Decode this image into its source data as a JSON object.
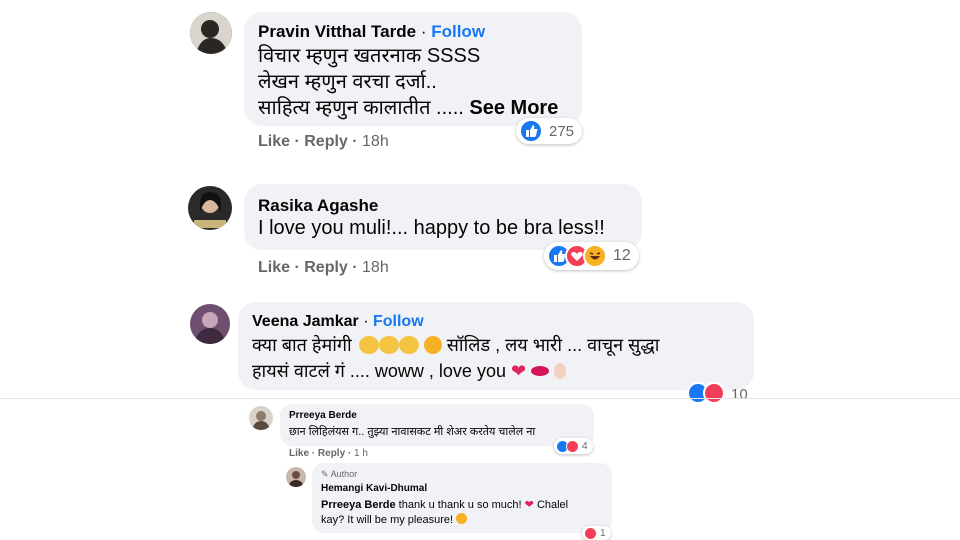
{
  "comments": [
    {
      "name": "Pravin Vitthal Tarde",
      "follow": "Follow",
      "lines": [
        "विचार म्हणुन खतरनाक SSSS",
        "लेखन म्हणुन वरचा दर्जा..",
        "साहित्य म्हणुन कालातीत ....."
      ],
      "see_more": "See More",
      "like": "Like",
      "reply": "Reply",
      "time": "18h",
      "reaction_count": "275"
    },
    {
      "name": "Rasika Agashe",
      "lines": [
        "I love you muli!... happy to be bra less!!"
      ],
      "like": "Like",
      "reply": "Reply",
      "time": "18h",
      "reaction_count": "12"
    },
    {
      "name": "Veena Jamkar",
      "follow": "Follow",
      "line1_a": "क्या बात हेमांगी",
      "line1_b": "सॉलिड , लय भारी ... वाचून सुद्धा",
      "line2": "हायसं वाटलं गं .... woww , love you",
      "reaction_count": "10"
    }
  ],
  "replies": [
    {
      "name": "Prreeya Berde",
      "text": "छान लिहिलंयस ग.. तुझ्या नावासकट मी शेअर करतेय चालेल ना",
      "like": "Like",
      "reply": "Reply",
      "time": "1 h",
      "reaction_count": "4"
    },
    {
      "author_badge": "Author",
      "name": "Hemangi Kavi-Dhumal",
      "mention": "Prreeya Berde",
      "text1": "thank u thank u so much!",
      "text1_b": "Chalel",
      "text2": "kay? It will be my pleasure!",
      "reaction_count": "1"
    }
  ],
  "colors": {
    "like_blue": "#1877f2",
    "love_red": "#f33e58",
    "bubble": "#f0f2f5",
    "meta_gray": "#65676b"
  }
}
